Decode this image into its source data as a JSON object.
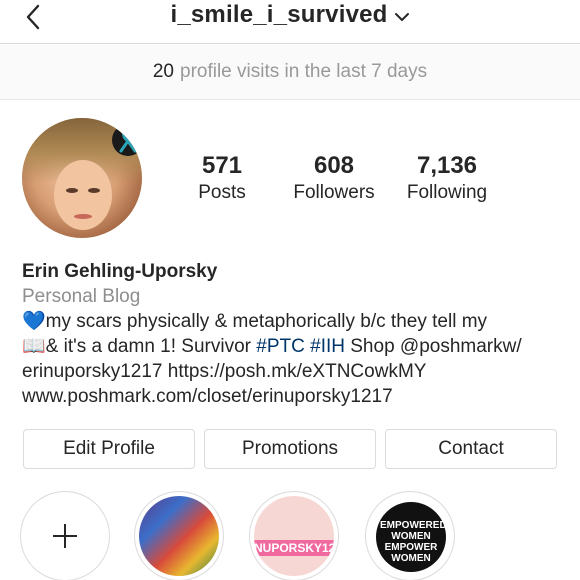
{
  "header": {
    "username": "i_smile_i_survived"
  },
  "visits_banner": {
    "count": "20",
    "text": "profile visits in the last 7 days"
  },
  "stats": {
    "posts": {
      "value": "571",
      "label": "Posts"
    },
    "followers": {
      "value": "608",
      "label": "Followers"
    },
    "following": {
      "value": "7,136",
      "label": "Following"
    }
  },
  "bio": {
    "name": "Erin Gehling-Uporsky",
    "category": "Personal Blog",
    "line1": "💙my scars physically & metaphorically b/c they tell my",
    "line2_a": "📖& it's a damn 1! Survivor ",
    "tag1": "#PTC",
    "tag2": "#IIH",
    "line2_b": " Shop @poshmarkw/",
    "line3": "erinuporsky1217 https://posh.mk/eXTNCowkMY",
    "website": "www.poshmark.com/closet/erinuporsky1217"
  },
  "buttons": {
    "edit_profile": "Edit Profile",
    "promotions": "Promotions",
    "contact": "Contact"
  },
  "highlights": {
    "items": [
      {
        "icon": "plus-icon"
      },
      {
        "icon": "colorful-stickers-thumbnail"
      },
      {
        "band_text": "NUPORSKY12"
      },
      {
        "text": "EMPOWERED WOMEN EMPOWER WOMEN"
      }
    ]
  },
  "colors": {
    "link": "#003569",
    "muted": "#8e8e8e",
    "border": "#dbdbdb"
  }
}
